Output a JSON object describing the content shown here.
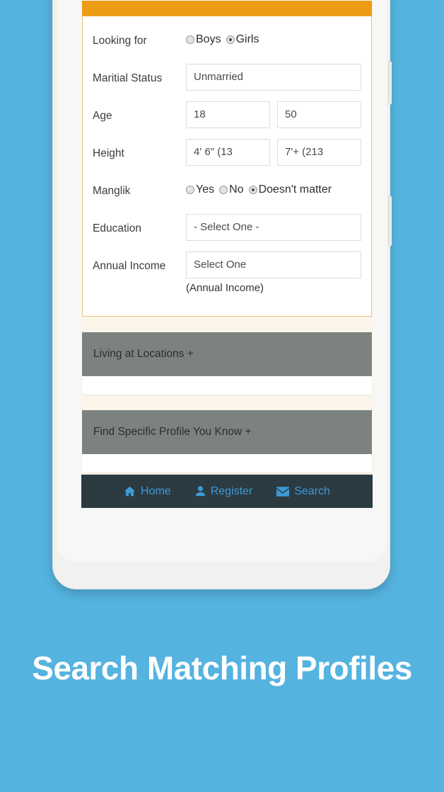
{
  "theme": {
    "background_blue": "#55b3df",
    "header_orange": "#ed9c16",
    "panel_border_gold": "#e3c778",
    "accordion_gray": "#7c8280",
    "nav_background": "#2c3a42",
    "nav_accent_blue": "#3d9ad4",
    "page_background": "#fbf5ea"
  },
  "headline": "Search Matching Profiles",
  "form": {
    "rows": [
      {
        "label": "Looking for",
        "type": "radio",
        "options": [
          {
            "label": "Boys",
            "selected": false
          },
          {
            "label": "Girls",
            "selected": true
          }
        ]
      },
      {
        "label": "Maritial Status",
        "type": "select",
        "value": "Unmarried"
      },
      {
        "label": "Age",
        "type": "select-pair",
        "from": "18",
        "to": "50"
      },
      {
        "label": "Height",
        "type": "select-pair",
        "from": "4' 6\" (13",
        "to": "7'+ (213"
      },
      {
        "label": "Manglik",
        "type": "radio",
        "options": [
          {
            "label": "Yes",
            "selected": false
          },
          {
            "label": "No",
            "selected": false
          },
          {
            "label": "Doesn't matter",
            "selected": true
          }
        ]
      },
      {
        "label": "Education",
        "type": "select",
        "value": "- Select One -"
      },
      {
        "label": "Annual Income",
        "type": "select",
        "value": "Select One",
        "hint": "(Annual Income)"
      }
    ]
  },
  "accordions": [
    {
      "title": "Living at Locations +"
    },
    {
      "title": "Find Specific Profile You Know +"
    }
  ],
  "bottom_nav": {
    "items": [
      {
        "label": "Home",
        "icon": "home-icon"
      },
      {
        "label": "Register",
        "icon": "user-icon"
      },
      {
        "label": "Search",
        "icon": "envelope-icon"
      }
    ]
  }
}
